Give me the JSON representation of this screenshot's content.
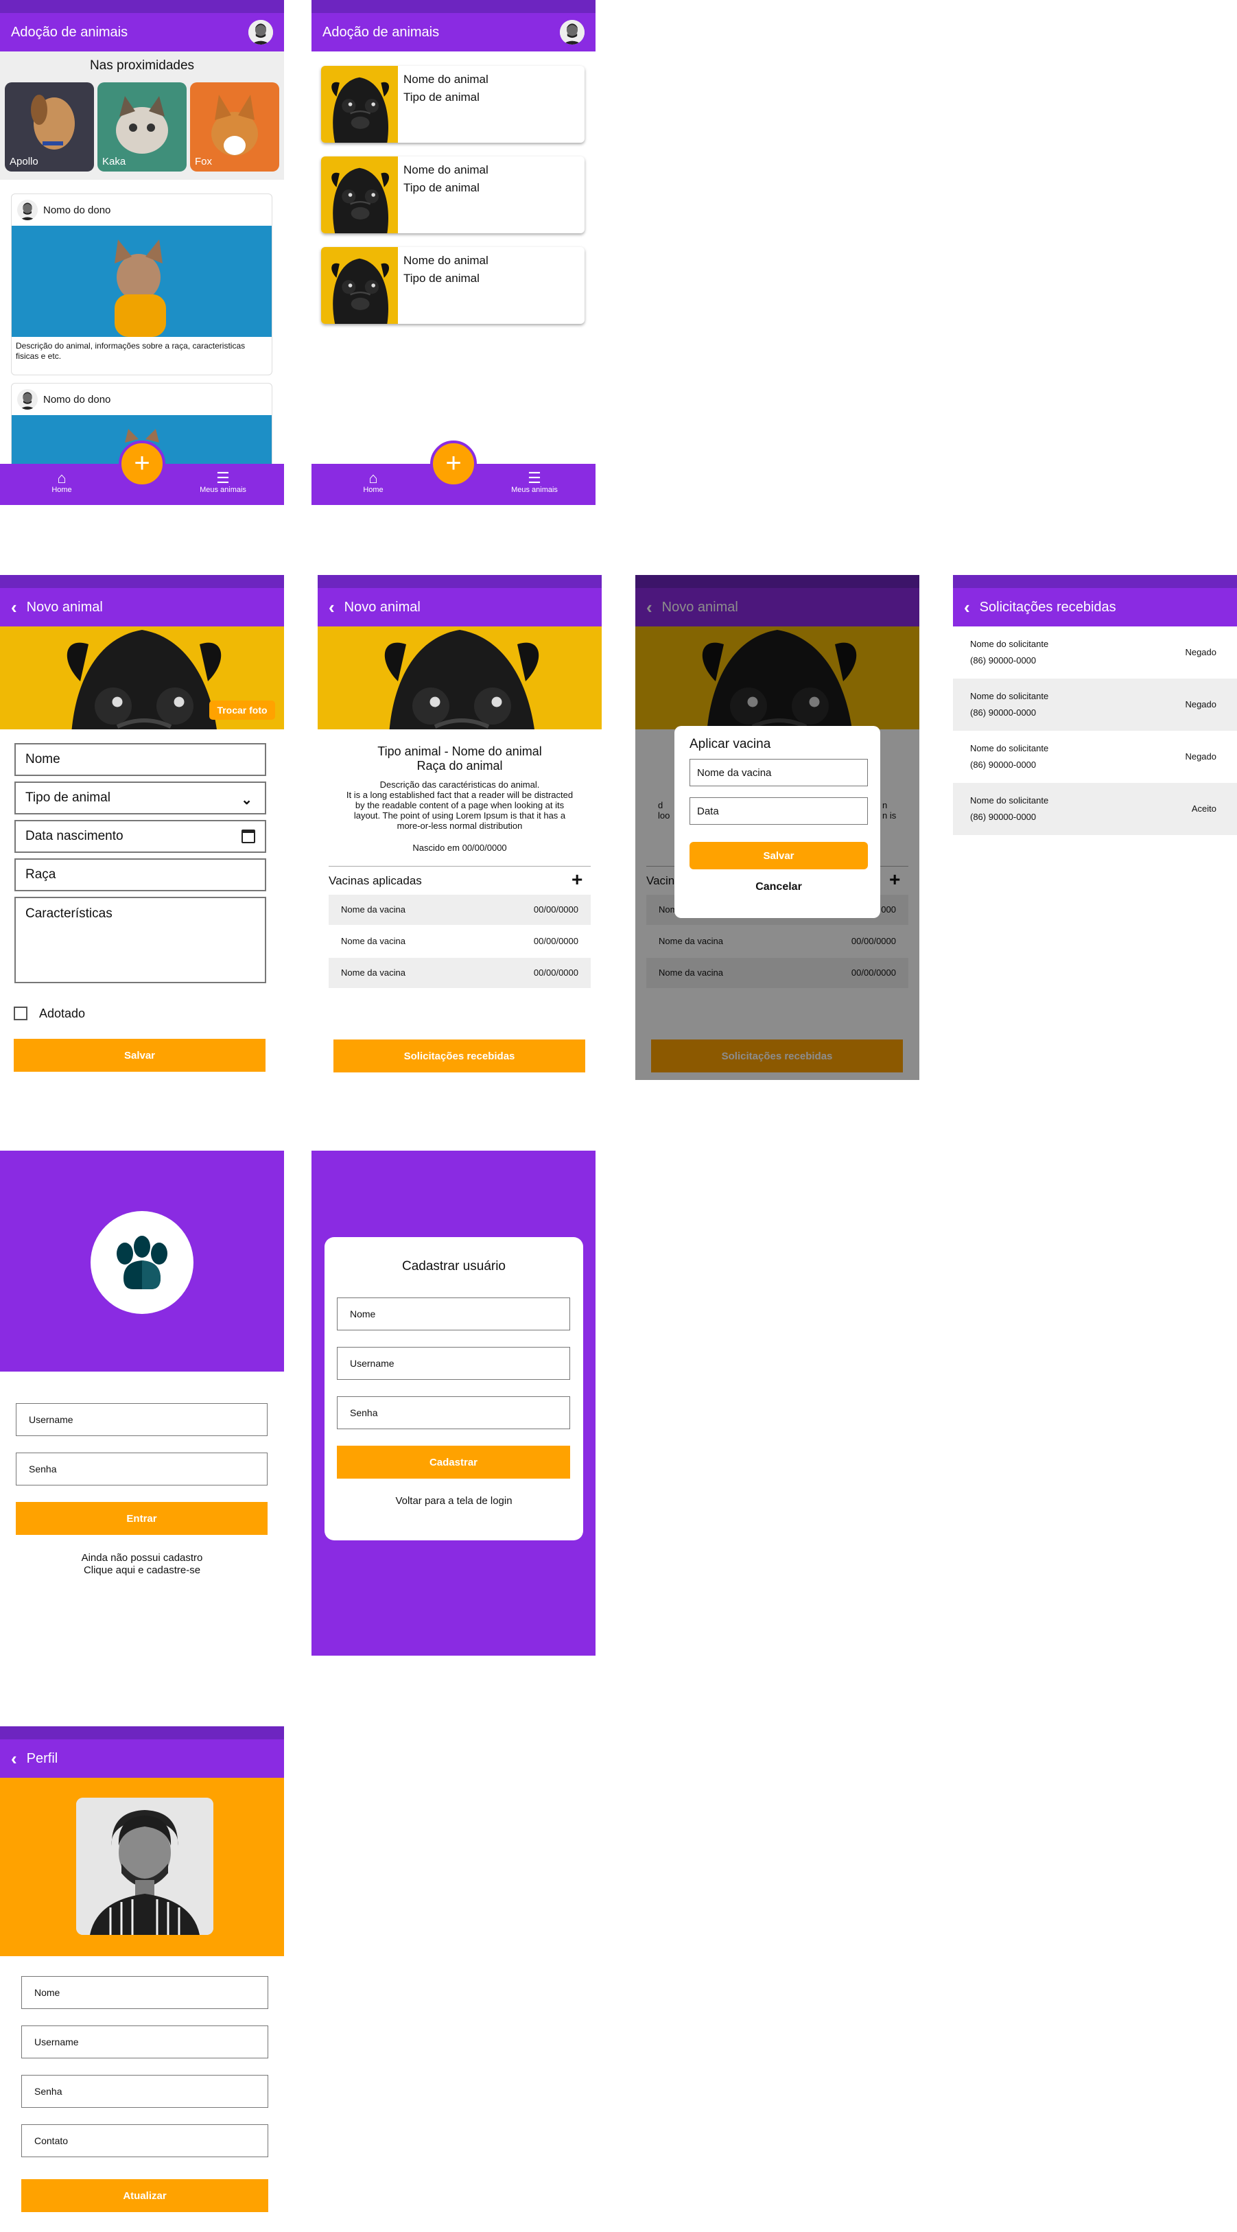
{
  "home": {
    "title": "Adoção de animais",
    "nearby_title": "Nas proximidades",
    "nearby": [
      {
        "name": "Apollo",
        "color": "#3a3a48"
      },
      {
        "name": "Kaka",
        "color": "#3f8f7a"
      },
      {
        "name": "Fox",
        "color": "#e8752a"
      }
    ],
    "posts": [
      {
        "owner": "Nomo do dono",
        "description": "Descrição do animal, informações sobre a raça, caracteristicas fisicas e etc."
      },
      {
        "owner": "Nomo do dono",
        "description": ""
      }
    ],
    "nav": {
      "home": "Home",
      "my_animals": "Meus animais",
      "home_icon": "home-icon",
      "menu_icon": "menu-icon",
      "fab": "+"
    }
  },
  "my_animals": {
    "title": "Adoção de animais",
    "items": [
      {
        "name": "Nome do animal",
        "type": "Tipo de animal"
      },
      {
        "name": "Nome do animal",
        "type": "Tipo de animal"
      },
      {
        "name": "Nome do animal",
        "type": "Tipo de animal"
      }
    ]
  },
  "new_animal": {
    "title": "Novo animal",
    "change_photo": "Trocar foto",
    "fields": {
      "name": "Nome",
      "type": "Tipo de animal",
      "birth": "Data nascimento",
      "breed": "Raça",
      "features": "Características"
    },
    "adopted": "Adotado",
    "save": "Salvar"
  },
  "detail": {
    "title": "Novo animal",
    "heading1": "Tipo animal - Nome do animal",
    "heading2": "Raça do animal",
    "desc1": "Descrição das caractéristicas do animal.",
    "desc2": "It is a long established fact that a reader will be distracted by the readable content of a page when looking at its layout. The point of using Lorem Ipsum is that it has a more-or-less normal distribution",
    "born": "Nascido em 00/00/0000",
    "vaccines_title": "Vacinas aplicadas",
    "vaccines": [
      {
        "name": "Nome da vacina",
        "date": "00/00/0000"
      },
      {
        "name": "Nome da vacina",
        "date": "00/00/0000"
      },
      {
        "name": "Nome da vacina",
        "date": "00/00/0000"
      }
    ],
    "requests_btn": "Solicitações recebidas"
  },
  "dialog": {
    "title": "Aplicar vacina",
    "vaccine_name": "Nome da vacina",
    "date": "Data",
    "save": "Salvar",
    "cancel": "Cancelar",
    "peek_vaccines": "Vacin",
    "peek_names": [
      "Nom",
      "Nome da vacina",
      "Nome da vacina"
    ],
    "peek_left": [
      "d",
      "loo"
    ],
    "peek_right": [
      "n",
      "n is"
    ],
    "peek_date": "000"
  },
  "requests": {
    "title": "Solicitações recebidas",
    "items": [
      {
        "name": "Nome do solicitante",
        "phone": "(86) 90000-0000",
        "status": "Negado"
      },
      {
        "name": "Nome do solicitante",
        "phone": "(86) 90000-0000",
        "status": "Negado"
      },
      {
        "name": "Nome do solicitante",
        "phone": "(86) 90000-0000",
        "status": "Negado"
      },
      {
        "name": "Nome do solicitante",
        "phone": "(86) 90000-0000",
        "status": "Aceito"
      }
    ]
  },
  "login": {
    "logo_icon": "paw-icon",
    "username": "Username",
    "password": "Senha",
    "enter": "Entrar",
    "no_account": "Ainda não possui cadastro",
    "signup_link": "Clique aqui e cadastre-se"
  },
  "register": {
    "title": "Cadastrar usuário",
    "name": "Nome",
    "username": "Username",
    "password": "Senha",
    "submit": "Cadastrar",
    "back_link": "Voltar para a tela de login"
  },
  "profile": {
    "title": "Perfil",
    "name": "Nome",
    "username": "Username",
    "password": "Senha",
    "contact": "Contato",
    "update": "Atualizar"
  },
  "colors": {
    "purple": "#8a2be2",
    "purple_dark": "#6d25c0",
    "orange": "#ffa200",
    "pug_yellow": "#f0b905"
  }
}
